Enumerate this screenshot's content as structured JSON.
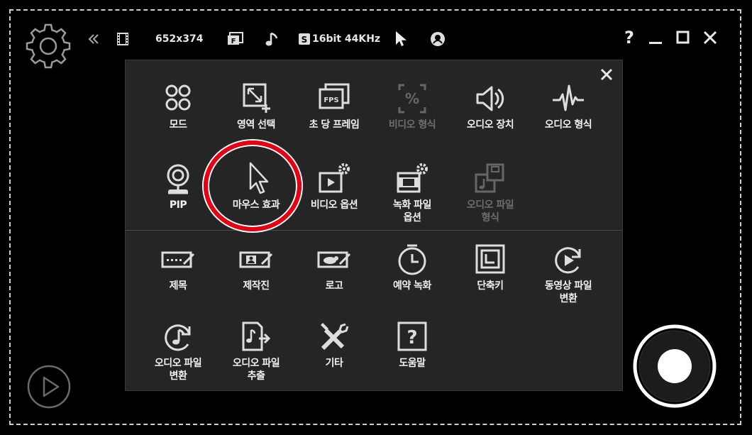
{
  "topbar": {
    "resolution": "652x374",
    "audio_format": "16bit 44KHz",
    "help_label": "?"
  },
  "menu": {
    "row1": [
      {
        "id": "mode",
        "label": "모드",
        "icon": "mode-icon",
        "enabled": true
      },
      {
        "id": "region",
        "label": "영역 선택",
        "icon": "region-select-icon",
        "enabled": true
      },
      {
        "id": "fps",
        "label": "초 당 프레임",
        "icon": "fps-icon",
        "enabled": true
      },
      {
        "id": "video-format",
        "label": "비디오 형식",
        "icon": "percent-icon",
        "enabled": false
      },
      {
        "id": "audio-device",
        "label": "오디오 장치",
        "icon": "speaker-icon",
        "enabled": true
      },
      {
        "id": "audio-format",
        "label": "오디오 형식",
        "icon": "waveform-icon",
        "enabled": true
      }
    ],
    "row2": [
      {
        "id": "pip",
        "label": "PIP",
        "icon": "webcam-icon",
        "enabled": true
      },
      {
        "id": "mouse-effect",
        "label": "마우스 효과",
        "icon": "cursor-icon",
        "enabled": true
      },
      {
        "id": "video-options",
        "label": "비디오 옵션",
        "icon": "video-options-icon",
        "enabled": true
      },
      {
        "id": "record-file-options",
        "label": "녹화 파일\n옵션",
        "icon": "film-options-icon",
        "enabled": true
      },
      {
        "id": "audio-file-format",
        "label": "오디오 파일\n형식",
        "icon": "audio-file-icon",
        "enabled": false
      }
    ],
    "row3": [
      {
        "id": "title",
        "label": "제목",
        "icon": "title-icon",
        "enabled": true
      },
      {
        "id": "author",
        "label": "제작진",
        "icon": "author-icon",
        "enabled": true
      },
      {
        "id": "logo",
        "label": "로고",
        "icon": "logo-icon",
        "enabled": true
      },
      {
        "id": "scheduled-recording",
        "label": "예약 녹화",
        "icon": "clock-icon",
        "enabled": true
      },
      {
        "id": "hotkeys",
        "label": "단축키",
        "icon": "hotkey-icon",
        "enabled": true
      },
      {
        "id": "video-convert",
        "label": "동영상 파일\n변환",
        "icon": "convert-video-icon",
        "enabled": true
      }
    ],
    "row4": [
      {
        "id": "audio-convert",
        "label": "오디오 파일\n변환",
        "icon": "convert-audio-icon",
        "enabled": true
      },
      {
        "id": "audio-extract",
        "label": "오디오 파일\n추출",
        "icon": "extract-audio-icon",
        "enabled": true
      },
      {
        "id": "etc",
        "label": "기타",
        "icon": "tools-icon",
        "enabled": true
      },
      {
        "id": "help",
        "label": "도움말",
        "icon": "help-icon",
        "enabled": true
      }
    ]
  },
  "colors": {
    "highlight": "#e60012",
    "panel": "#252525",
    "disabled": "#6d6d6d"
  }
}
